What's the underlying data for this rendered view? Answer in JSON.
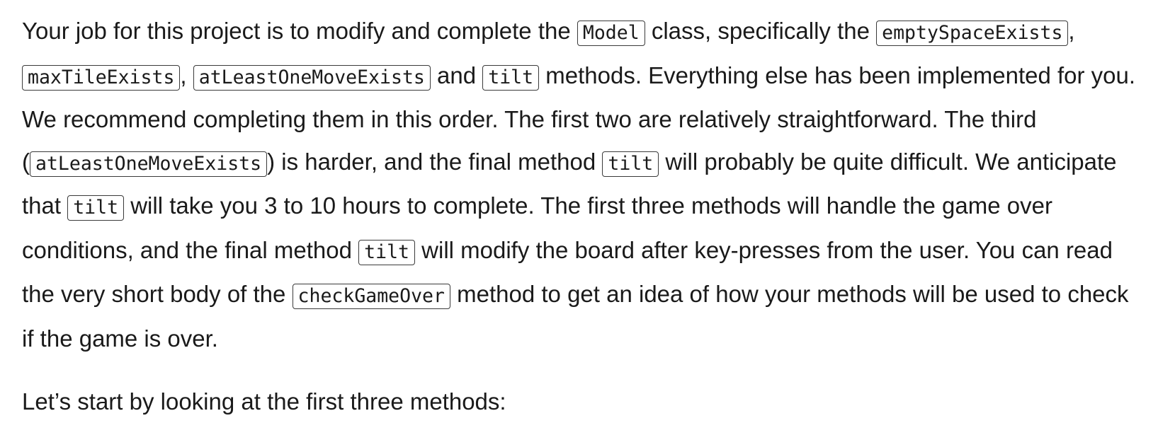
{
  "paragraphs": [
    {
      "segments": [
        {
          "text": "Your job for this project is to modify and complete the "
        },
        {
          "code": "Model"
        },
        {
          "text": " class, specifically the "
        },
        {
          "code": "emptySpaceExists"
        },
        {
          "text": ", "
        },
        {
          "code": "maxTileExists"
        },
        {
          "text": ", "
        },
        {
          "code": "atLeastOneMoveExists"
        },
        {
          "text": " and "
        },
        {
          "code": "tilt"
        },
        {
          "text": " methods. Everything else has been implemented for you. We recommend completing them in this order. The first two are relatively straightforward. The third ("
        },
        {
          "code": "atLeastOneMoveExists"
        },
        {
          "text": ") is harder, and the final method "
        },
        {
          "code": "tilt"
        },
        {
          "text": " will probably be quite difficult. We anticipate that "
        },
        {
          "code": "tilt"
        },
        {
          "text": " will take you 3 to 10 hours to complete. The first three methods will handle the game over conditions, and the final method "
        },
        {
          "code": "tilt"
        },
        {
          "text": " will modify the board after key-presses from the user. You can read the very short body of the "
        },
        {
          "code": "checkGameOver"
        },
        {
          "text": " method to get an idea of how your methods will be used to check if the game is over."
        }
      ]
    },
    {
      "segments": [
        {
          "text": "Let’s start by looking at the first three methods:"
        }
      ]
    }
  ]
}
